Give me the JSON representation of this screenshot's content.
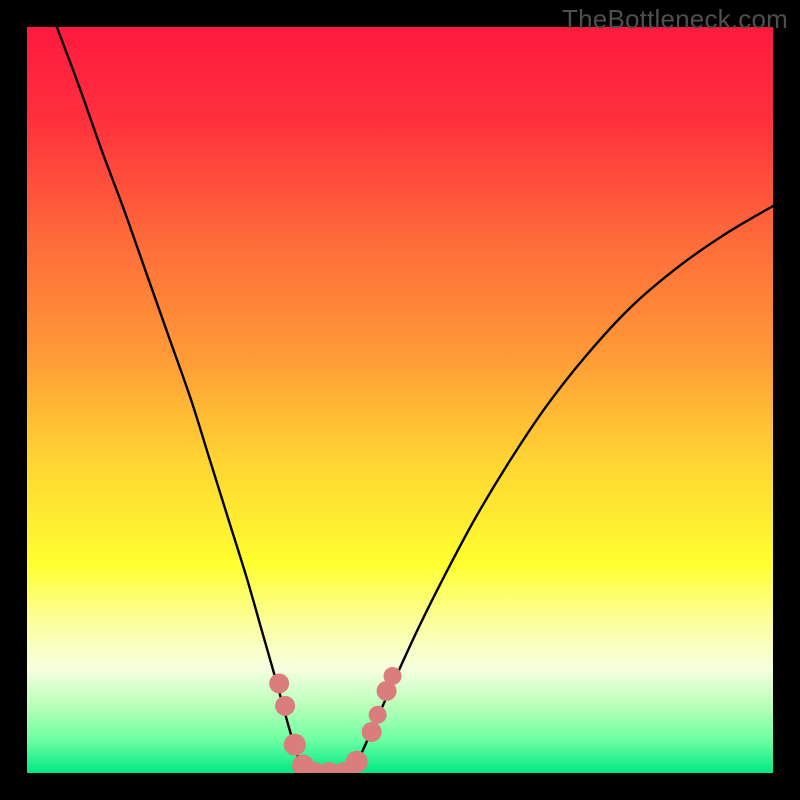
{
  "watermark": "TheBottleneck.com",
  "chart_data": {
    "type": "line",
    "title": "",
    "xlabel": "",
    "ylabel": "",
    "xlim": [
      0,
      1
    ],
    "ylim": [
      0,
      1
    ],
    "background_gradient": {
      "stops": [
        {
          "offset": 0.0,
          "color": "#ff1a3f"
        },
        {
          "offset": 0.12,
          "color": "#ff2f3d"
        },
        {
          "offset": 0.28,
          "color": "#ff693a"
        },
        {
          "offset": 0.44,
          "color": "#ff9a37"
        },
        {
          "offset": 0.58,
          "color": "#ffd433"
        },
        {
          "offset": 0.72,
          "color": "#ffff30"
        },
        {
          "offset": 0.8,
          "color": "#fcffa0"
        },
        {
          "offset": 0.86,
          "color": "#f6ffe0"
        },
        {
          "offset": 0.91,
          "color": "#b9ffb9"
        },
        {
          "offset": 0.955,
          "color": "#6effa3"
        },
        {
          "offset": 1.0,
          "color": "#00e884"
        }
      ]
    },
    "series": [
      {
        "name": "left-curve",
        "stroke": "#000000",
        "points": [
          [
            0.04,
            1.0
          ],
          [
            0.07,
            0.92
          ],
          [
            0.1,
            0.835
          ],
          [
            0.13,
            0.755
          ],
          [
            0.16,
            0.67
          ],
          [
            0.19,
            0.585
          ],
          [
            0.22,
            0.5
          ],
          [
            0.245,
            0.42
          ],
          [
            0.27,
            0.34
          ],
          [
            0.295,
            0.26
          ],
          [
            0.315,
            0.19
          ],
          [
            0.335,
            0.12
          ],
          [
            0.35,
            0.065
          ],
          [
            0.362,
            0.025
          ],
          [
            0.372,
            0.0
          ]
        ]
      },
      {
        "name": "right-curve",
        "stroke": "#000000",
        "points": [
          [
            0.435,
            0.0
          ],
          [
            0.45,
            0.03
          ],
          [
            0.47,
            0.075
          ],
          [
            0.495,
            0.13
          ],
          [
            0.525,
            0.195
          ],
          [
            0.56,
            0.265
          ],
          [
            0.6,
            0.34
          ],
          [
            0.645,
            0.415
          ],
          [
            0.695,
            0.49
          ],
          [
            0.75,
            0.56
          ],
          [
            0.81,
            0.625
          ],
          [
            0.875,
            0.68
          ],
          [
            0.94,
            0.725
          ],
          [
            1.0,
            0.76
          ]
        ]
      }
    ],
    "markers": [
      {
        "x": 0.338,
        "y": 0.12,
        "r": 10,
        "color": "#d97d7d"
      },
      {
        "x": 0.346,
        "y": 0.09,
        "r": 10,
        "color": "#d97d7d"
      },
      {
        "x": 0.359,
        "y": 0.038,
        "r": 11,
        "color": "#d97d7d"
      },
      {
        "x": 0.37,
        "y": 0.01,
        "r": 11,
        "color": "#d97d7d"
      },
      {
        "x": 0.385,
        "y": 0.0,
        "r": 11,
        "color": "#d97d7d"
      },
      {
        "x": 0.405,
        "y": 0.0,
        "r": 11,
        "color": "#d97d7d"
      },
      {
        "x": 0.425,
        "y": 0.0,
        "r": 11,
        "color": "#d97d7d"
      },
      {
        "x": 0.442,
        "y": 0.015,
        "r": 11,
        "color": "#d97d7d"
      },
      {
        "x": 0.462,
        "y": 0.055,
        "r": 10,
        "color": "#d97d7d"
      },
      {
        "x": 0.47,
        "y": 0.078,
        "r": 9,
        "color": "#d97d7d"
      },
      {
        "x": 0.482,
        "y": 0.11,
        "r": 10,
        "color": "#d97d7d"
      },
      {
        "x": 0.49,
        "y": 0.13,
        "r": 9,
        "color": "#d97d7d"
      }
    ]
  }
}
